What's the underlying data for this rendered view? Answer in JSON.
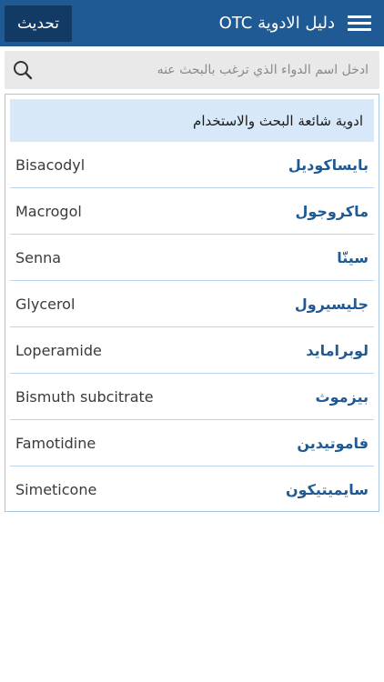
{
  "appbar": {
    "title": "دليل الادوية OTC",
    "refresh_label": "تحديث",
    "menu_icon": "hamburger-menu-icon",
    "color": "#1f5a95",
    "button_color": "#123a64"
  },
  "search": {
    "placeholder": "ادخل اسم الدواء الذي ترغب بالبحث عنه",
    "value": "",
    "icon": "search-icon"
  },
  "list": {
    "header": "ادوية شائعة البحث والاستخدام",
    "header_color": "#d7e8f9",
    "items": [
      {
        "ar": "بايساكوديل",
        "en": "Bisacodyl"
      },
      {
        "ar": "ماكروجول",
        "en": "Macrogol"
      },
      {
        "ar": "سينّا",
        "en": "Senna"
      },
      {
        "ar": "جليسيرول",
        "en": "Glycerol"
      },
      {
        "ar": "لوبرامايد",
        "en": "Loperamide"
      },
      {
        "ar": "بيزموث",
        "en": "Bismuth subcitrate"
      },
      {
        "ar": "فاموتيدين",
        "en": "Famotidine"
      },
      {
        "ar": "سايميتيكون",
        "en": "Simeticone"
      }
    ]
  }
}
